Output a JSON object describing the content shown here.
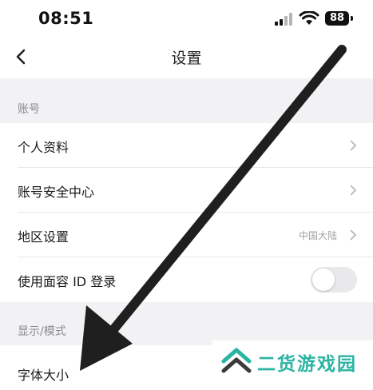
{
  "status_bar": {
    "time": "08:51",
    "battery": "88",
    "icons": [
      "signal-icon",
      "wifi-icon",
      "battery-icon"
    ]
  },
  "nav": {
    "back_icon": "chevron-left-icon",
    "title": "设置"
  },
  "sections": [
    {
      "header": "账号",
      "rows": [
        {
          "label": "个人资料",
          "value": "",
          "accessory": "chevron"
        },
        {
          "label": "账号安全中心",
          "value": "",
          "accessory": "chevron"
        },
        {
          "label": "地区设置",
          "value": "中国大陆",
          "accessory": "chevron"
        },
        {
          "label": "使用面容 ID 登录",
          "value": "",
          "accessory": "toggle",
          "toggle_on": false
        }
      ]
    },
    {
      "header": "显示/模式",
      "rows": [
        {
          "label": "字体大小",
          "value": "",
          "accessory": "chevron"
        }
      ]
    }
  ],
  "watermark": {
    "text": "二货游戏园",
    "color": "#2bb3a3"
  },
  "colors": {
    "arrow": "#1f1f1f",
    "background": "#f2f2f4",
    "row_background": "#ffffff",
    "secondary_text": "#8a8a8e"
  }
}
